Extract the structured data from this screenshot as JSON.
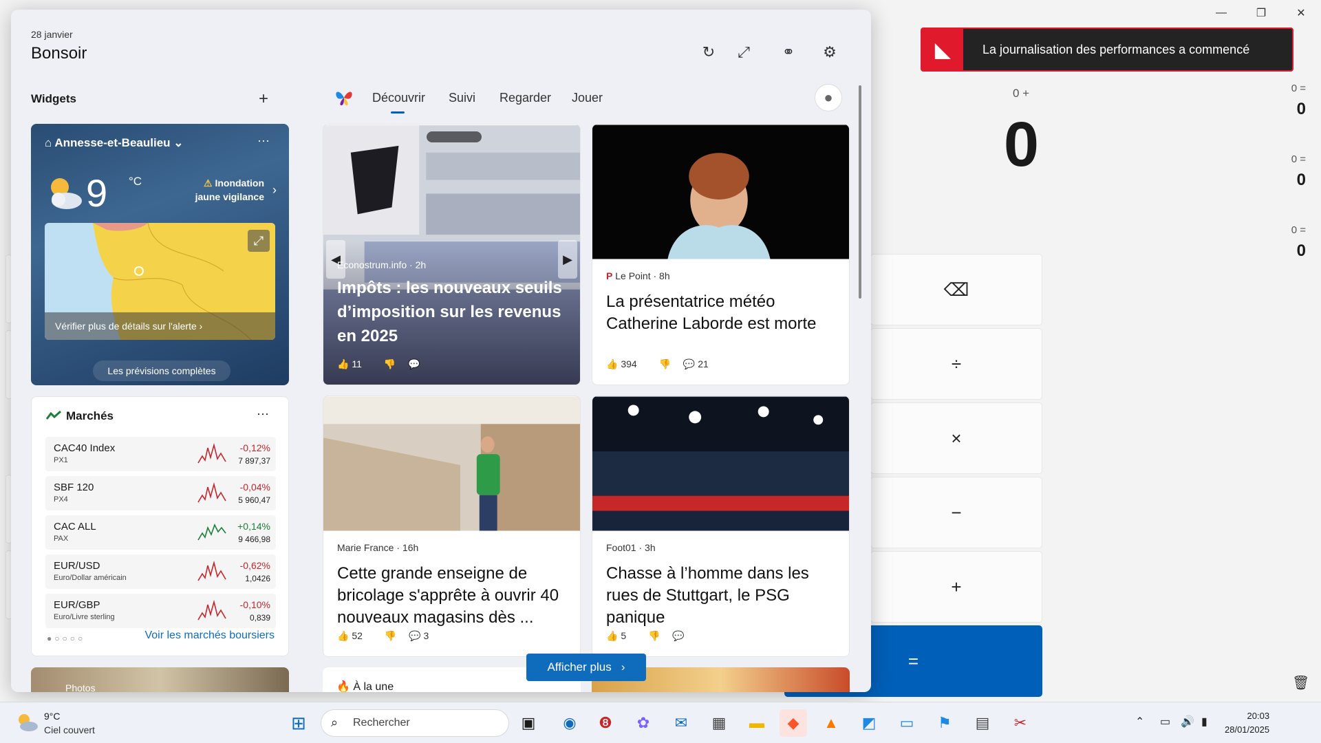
{
  "notification": {
    "text": "La journalisation des performances a commencé"
  },
  "calculator": {
    "history_label": "0 +",
    "display": "0",
    "memory": [
      {
        "expr": "0 =",
        "value": "0"
      },
      {
        "expr": "0 =",
        "value": "0"
      },
      {
        "expr": "0 =",
        "value": "0"
      }
    ],
    "buttons": [
      "⌫",
      "÷",
      "×",
      "−",
      "+",
      "="
    ]
  },
  "board": {
    "date": "28 janvier",
    "greeting": "Bonsoir",
    "widgets_title": "Widgets",
    "add_glyph": "+",
    "tabs": [
      {
        "label": "Découvrir"
      },
      {
        "label": "Suivi"
      },
      {
        "label": "Regarder"
      },
      {
        "label": "Jouer"
      }
    ],
    "weather": {
      "location": "Annesse-et-Beaulieu",
      "temp": "9",
      "unit": "°C",
      "alert_line1": "Inondation",
      "alert_line2": "jaune vigilance",
      "map_link": "Vérifier plus de détails sur l'alerte",
      "forecast_link": "Les prévisions complètes"
    },
    "markets": {
      "title": "Marchés",
      "rows": [
        {
          "name": "CAC40 Index",
          "sub": "PX1",
          "change": "-0,12%",
          "price": "7 897,37",
          "trend": "neg"
        },
        {
          "name": "SBF 120",
          "sub": "PX4",
          "change": "-0,04%",
          "price": "5 960,47",
          "trend": "neg"
        },
        {
          "name": "CAC ALL",
          "sub": "PAX",
          "change": "+0,14%",
          "price": "9 466,98",
          "trend": "pos"
        },
        {
          "name": "EUR/USD",
          "sub": "Euro/Dollar américain",
          "change": "-0,62%",
          "price": "1,0426",
          "trend": "neg"
        },
        {
          "name": "EUR/GBP",
          "sub": "Euro/Livre sterling",
          "change": "-0,10%",
          "price": "0,839",
          "trend": "neg"
        }
      ],
      "see_all": "Voir les marchés boursiers"
    },
    "photos_label": "Photos",
    "news": [
      {
        "source": "Econostrum.info · 2h",
        "title": "Impôts : les nouveaux seuils d’imposition sur les revenus en 2025",
        "likes": "11",
        "comments": ""
      },
      {
        "source": "Le Point · 8h",
        "title": "La présentatrice météo Catherine Laborde est morte",
        "likes": "394",
        "comments": "21"
      },
      {
        "source": "Marie France · 16h",
        "title": "Cette grande enseigne de bricolage s'apprête à ouvrir 40 nouveaux magasins dès ...",
        "likes": "52",
        "comments": "3"
      },
      {
        "source": "Foot01 · 3h",
        "title": "Chasse à l’homme dans les rues de Stuttgart, le PSG panique",
        "likes": "5",
        "comments": ""
      }
    ],
    "more_button": "Afficher plus",
    "headline_strip": "À la une"
  },
  "taskbar": {
    "weather_temp": "9°C",
    "weather_cond": "Ciel couvert",
    "search_placeholder": "Rechercher",
    "time": "20:03",
    "date": "28/01/2025"
  },
  "colors": {
    "accent": "#005fb8",
    "alert_red": "#e0192d",
    "negative": "#c4262e",
    "positive": "#1a7f37"
  }
}
